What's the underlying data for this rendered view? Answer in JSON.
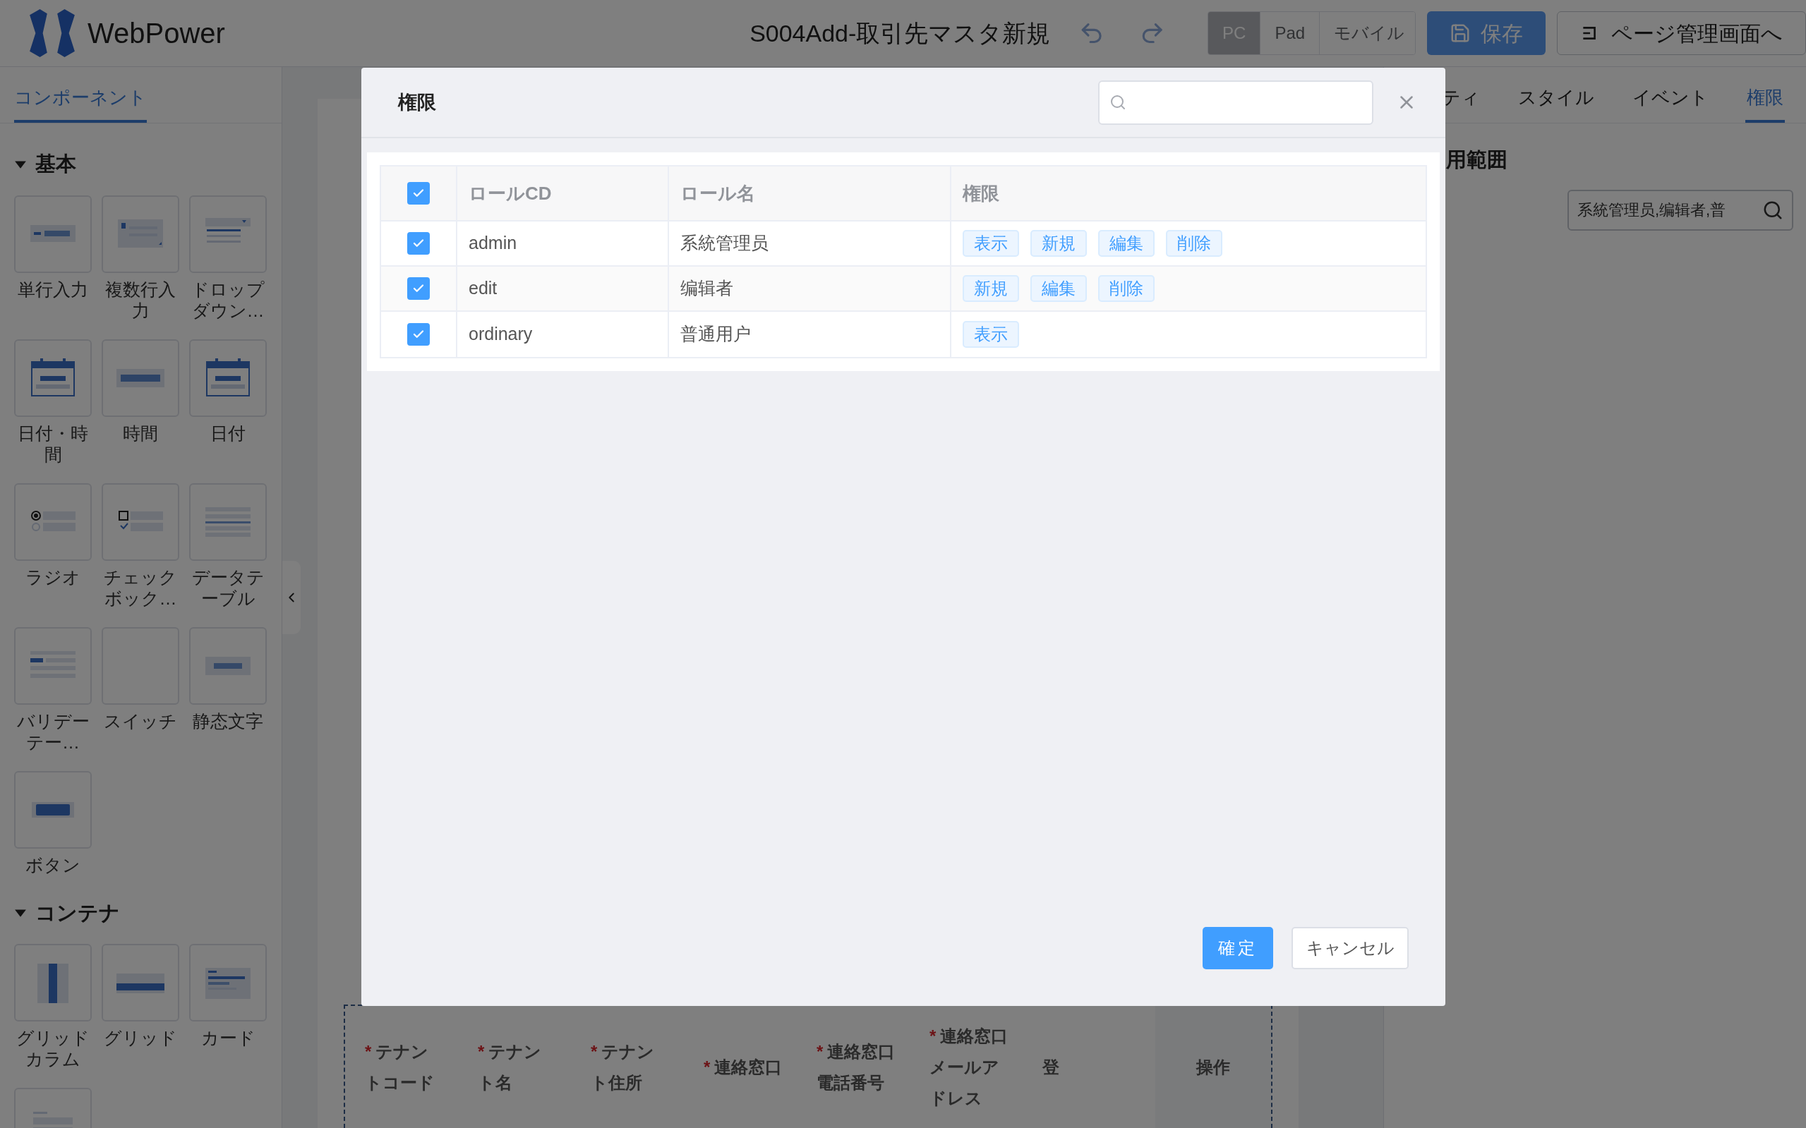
{
  "header": {
    "logo_text": "WebPower",
    "page_title": "S004Add-取引先マスタ新規",
    "devices": [
      {
        "label": "PC",
        "selected": true
      },
      {
        "label": "Pad",
        "selected": false
      },
      {
        "label": "モバイル",
        "selected": false
      }
    ],
    "save_button": "保存",
    "manage_button": "ページ管理画面へ"
  },
  "left_panel": {
    "tabs": [
      {
        "label": "コンポーネント",
        "selected": true
      }
    ],
    "sections": [
      {
        "title": "基本",
        "expanded": true,
        "items": [
          {
            "label": "単行入力",
            "kind": "input"
          },
          {
            "label": "複数行入力",
            "kind": "textarea"
          },
          {
            "label": "ドロップダウン…",
            "kind": "dropdown"
          },
          {
            "label": "日付・時間",
            "kind": "calendar"
          },
          {
            "label": "時間",
            "kind": "time"
          },
          {
            "label": "日付",
            "kind": "calendar"
          },
          {
            "label": "ラジオ",
            "kind": "radio"
          },
          {
            "label": "チェックボック…",
            "kind": "checkbox"
          },
          {
            "label": "データテーブル",
            "kind": "table"
          },
          {
            "label": "バリデーテー…",
            "kind": "validation"
          },
          {
            "label": "スイッチ",
            "kind": "blank"
          },
          {
            "label": "静态文字",
            "kind": "text"
          },
          {
            "label": "ボタン",
            "kind": "button"
          }
        ]
      },
      {
        "title": "コンテナ",
        "expanded": true,
        "items": [
          {
            "label": "グリッドカラム",
            "kind": "grid-column"
          },
          {
            "label": "グリッド",
            "kind": "grid"
          },
          {
            "label": "カード",
            "kind": "card"
          },
          {
            "kind": "form"
          }
        ]
      }
    ]
  },
  "canvas": {
    "columns": [
      {
        "mark": "*",
        "label": "テナントコード"
      },
      {
        "mark": "*",
        "label": "テナント名"
      },
      {
        "mark": "*",
        "label": "テナント住所"
      },
      {
        "mark": "*",
        "label": "連絡窓口"
      },
      {
        "mark": "*",
        "label": "連絡窓口電話番号"
      },
      {
        "mark": "*",
        "label": "連絡窓口メールアドレス"
      },
      {
        "label": "登"
      }
    ],
    "fixed_column": "操作"
  },
  "right_panel": {
    "tabs": [
      {
        "label": "ティ",
        "selected": false
      },
      {
        "label": "スタイル",
        "selected": false
      },
      {
        "label": "イベント",
        "selected": false
      },
      {
        "label": "権限",
        "selected": true
      }
    ],
    "section_title": "用範囲",
    "role_field": {
      "value": "系統管理员,编辑者,普"
    }
  },
  "dialog": {
    "title": "権限",
    "table": {
      "select_all": {
        "checked": true
      },
      "columns": [
        "ロールCD",
        "ロール名",
        "権限"
      ],
      "rows": [
        {
          "checked": true,
          "code": "admin",
          "name": "系統管理员",
          "permissions": [
            "表示",
            "新規",
            "編集",
            "削除"
          ]
        },
        {
          "checked": true,
          "code": "edit",
          "name": "编辑者",
          "permissions": [
            "新規",
            "編集",
            "削除"
          ]
        },
        {
          "checked": true,
          "code": "ordinary",
          "name": "普通用户",
          "permissions": [
            "表示"
          ]
        }
      ]
    },
    "confirm_button": "確定",
    "cancel_button": "キャンセル"
  }
}
